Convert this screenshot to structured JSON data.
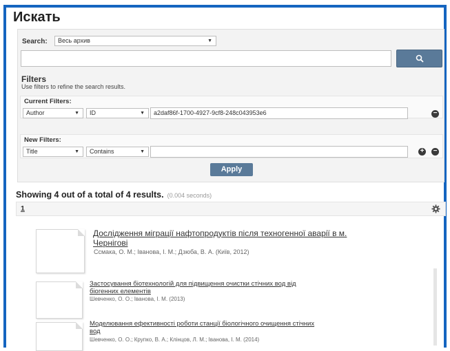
{
  "page": {
    "title": "Искать"
  },
  "search": {
    "label": "Search:",
    "scope": "Весь архив",
    "query": "",
    "button_icon": "search-icon"
  },
  "filters": {
    "heading": "Filters",
    "hint": "Use filters to refine the search results.",
    "current": {
      "heading": "Current Filters:",
      "field": "Author",
      "operator": "ID",
      "value": "a2daf86f-1700-4927-9cf8-248c043953e6"
    },
    "new": {
      "heading": "New Filters:",
      "field": "Title",
      "operator": "Contains",
      "value": ""
    },
    "apply_label": "Apply"
  },
  "results": {
    "summary": "Showing 4 out of a total of 4 results.",
    "time": "(0.004 seconds)",
    "page": "1",
    "items": [
      {
        "title_line1": "Дослідження міграції нафтопродуктів після техногенної аварії в м.",
        "title_line2": "Чернігові",
        "authors": "Ссмака, О. М.; Іванова, І. М.; Дзюба, В. А. (Київ, 2012)"
      },
      {
        "title_line1": "Застосування біотехнологій для підвищення очистки стічних вод від",
        "title_line2": "біогенних елементів",
        "authors": "Шевченко, О. О.; Іванова, І. М. (2013)"
      },
      {
        "title_line1": "Моделювання ефективності роботи станції біологічного очищення стічних",
        "title_line2": "вод",
        "authors": "Шевченко, О. О.; Крупко, В. А.; Клінцов, Л. М.; Іванова, І. М. (2014)"
      }
    ]
  }
}
